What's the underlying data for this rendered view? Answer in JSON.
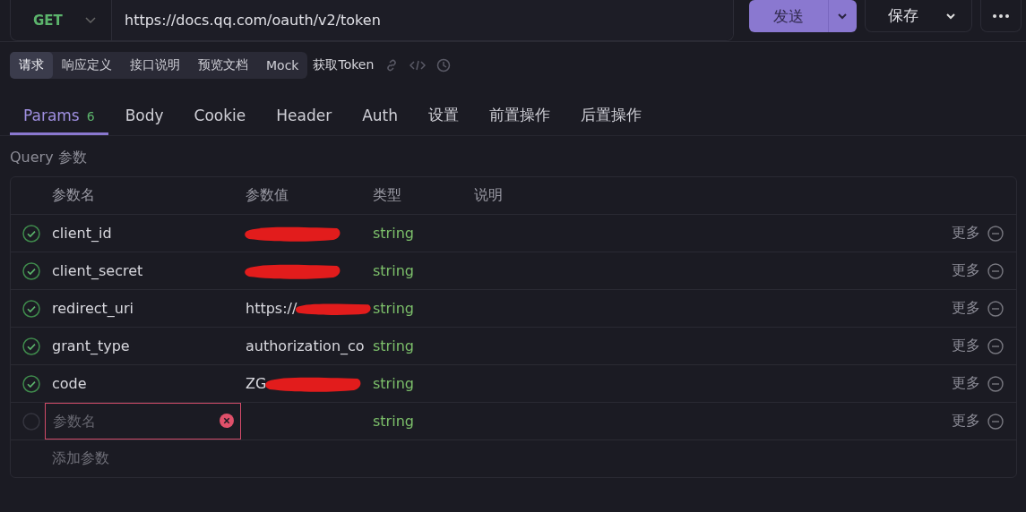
{
  "request_bar": {
    "method": "GET",
    "url": "https://docs.qq.com/oauth/v2/token",
    "send_label": "发送",
    "save_label": "保存"
  },
  "view_tabs": [
    {
      "label": "请求",
      "selected": true
    },
    {
      "label": "响应定义",
      "selected": false
    },
    {
      "label": "接口说明",
      "selected": false
    },
    {
      "label": "预览文档",
      "selected": false
    },
    {
      "label": "Mock",
      "selected": false
    }
  ],
  "endpoint_name": "获取Token",
  "tabs": [
    {
      "label": "Params",
      "count": "6",
      "selected": true
    },
    {
      "label": "Body",
      "selected": false
    },
    {
      "label": "Cookie",
      "selected": false
    },
    {
      "label": "Header",
      "selected": false
    },
    {
      "label": "Auth",
      "selected": false
    },
    {
      "label": "设置",
      "selected": false
    },
    {
      "label": "前置操作",
      "selected": false
    },
    {
      "label": "后置操作",
      "selected": false
    }
  ],
  "section_title": "Query 参数",
  "table": {
    "columns": [
      "参数名",
      "参数值",
      "类型",
      "说明"
    ],
    "rows": [
      {
        "kind": "param",
        "enabled": true,
        "name": "client_id",
        "redacted": true,
        "type": "string",
        "more": "更多"
      },
      {
        "kind": "param",
        "enabled": true,
        "name": "client_secret",
        "redacted": true,
        "type": "string",
        "more": "更多"
      },
      {
        "kind": "param",
        "enabled": true,
        "name": "redirect_uri",
        "value": "https://",
        "redacted": true,
        "type": "string",
        "more": "更多"
      },
      {
        "kind": "param",
        "enabled": true,
        "name": "grant_type",
        "value": "authorization_co",
        "redacted": false,
        "type": "string",
        "more": "更多"
      },
      {
        "kind": "param",
        "enabled": true,
        "name": "code",
        "value": "ZG",
        "redacted": true,
        "type": "string",
        "more": "更多"
      },
      {
        "kind": "new",
        "enabled": false,
        "placeholder": "参数名",
        "type": "string",
        "more": "更多"
      }
    ],
    "add_label": "添加参数"
  }
}
